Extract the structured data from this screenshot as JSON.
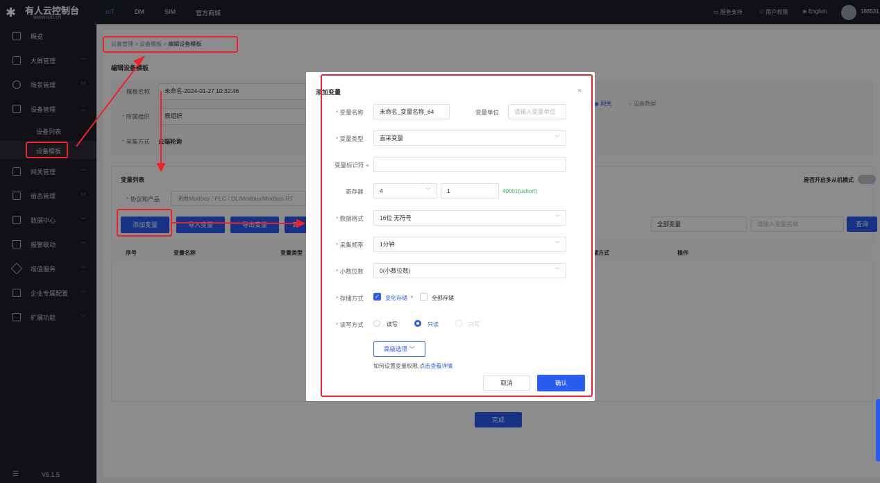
{
  "brand": {
    "name": "有人云控制台",
    "url": "www.usr.cn"
  },
  "topnav": [
    "IoT",
    "DM",
    "SIM",
    "官方商城"
  ],
  "top_right": {
    "support": "服务支持",
    "perm": "用户权限",
    "lang": "English",
    "user": "186531"
  },
  "sidebar": {
    "items": [
      {
        "label": "概览",
        "icon": "overview-icon"
      },
      {
        "label": "大屏管理",
        "icon": "screen-icon"
      },
      {
        "label": "场景管理",
        "icon": "scene-icon"
      },
      {
        "label": "设备管理",
        "icon": "device-icon"
      },
      {
        "label": "网关管理",
        "icon": "gateway-icon"
      },
      {
        "label": "组态管理",
        "icon": "config-icon"
      },
      {
        "label": "数据中心",
        "icon": "data-icon"
      },
      {
        "label": "报警联动",
        "icon": "alarm-icon"
      },
      {
        "label": "增值服务",
        "icon": "value-icon"
      },
      {
        "label": "企业专属配置",
        "icon": "enterprise-icon"
      },
      {
        "label": "扩展功能",
        "icon": "extend-icon"
      }
    ],
    "sub": [
      "设备列表",
      "设备模板"
    ],
    "version": "V6.1.5"
  },
  "breadcrumb": [
    "设备管理",
    "设备模板",
    "编辑设备模板"
  ],
  "page": {
    "title": "编辑设备模板",
    "form": {
      "name_label": "模板名称",
      "name_value": "未命名-2024-01-27 10:32:46",
      "org_label": "所属组织",
      "org_placeholder": "根组织",
      "collect_label": "采集方式",
      "collect_value": "云端轮询",
      "gw": "网关",
      "devdata": "设备数据"
    },
    "var_list_title": "变量列表",
    "multi_slave": "是否开启多从机模式",
    "protocol_label": "协议和产品",
    "protocol_value": "通用Modbus / PLC / DL/Modbus/Modbus RT",
    "buttons": {
      "add": "添加变量",
      "import": "导入变量",
      "export": "导出变量",
      "more": "其"
    },
    "filter": "全部变量",
    "search_ph": "请输入变量名称",
    "query": "查询",
    "columns": [
      "序号",
      "变量名称",
      "变量类型",
      "存储方式",
      "操作"
    ],
    "done": "完成"
  },
  "modal": {
    "title": "添加变量",
    "name_label": "变量名称",
    "name_value": "未命名_变量名称_64",
    "unit_label": "变量单位",
    "unit_ph": "请输入变量单位",
    "type_label": "变量类型",
    "type_value": "直采变量",
    "id_label": "变量标识符",
    "reg_label": "寄存器",
    "reg_value": "4",
    "reg_addr": "1",
    "reg_hint": "40001(ushort)",
    "fmt_label": "数据格式",
    "fmt_value": "16位 无符号",
    "freq_label": "采集频率",
    "freq_value": "1分钟",
    "dec_label": "小数位数",
    "dec_value": "0(小数位数)",
    "store_label": "存储方式",
    "store_opt1": "变化存储",
    "store_opt2": "全部存储",
    "rw_label": "读写方式",
    "rw_opts": [
      "读写",
      "只读",
      "只写"
    ],
    "adv": "高级选项",
    "help_text": "如何设置变量权限,",
    "help_link": "点击查看详情",
    "cancel": "取消",
    "ok": "确认"
  },
  "colors": {
    "accent": "#2a5cf0",
    "dark": "#1c1f26",
    "red": "#f0202a",
    "green": "#2fb34a"
  }
}
